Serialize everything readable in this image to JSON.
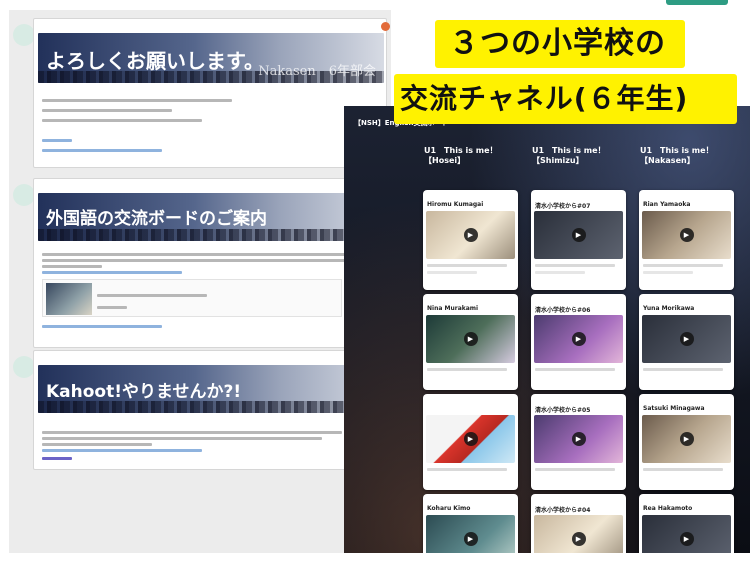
{
  "caption": {
    "line1": "３つの小学校の",
    "line2": "交流チャネル(６年生)"
  },
  "feed": {
    "avatar_label": "",
    "date_separator": "",
    "posts": [
      {
        "banner_title": "よろしくお願いします。",
        "banner_sub": "Nakasen　6年部会",
        "body_title": "",
        "reactions": "",
        "link_title": ""
      },
      {
        "banner_title": "外国語の交流ボードのご案内",
        "banner_sub": "",
        "body_title": "",
        "reactions": "",
        "link_title": ""
      },
      {
        "banner_title": "Kahoot!やりませんか?!",
        "banner_sub": "",
        "body_title": "",
        "reactions": "",
        "link_title": ""
      }
    ]
  },
  "board": {
    "crumb": "",
    "title": "【NSH】English交流ボード",
    "description": "",
    "columns": [
      {
        "line1": "U1　This is me！",
        "line2": "【Hosei】"
      },
      {
        "line1": "U1　This is me！",
        "line2": "【Shimizu】"
      },
      {
        "line1": "U1　This is me！",
        "line2": "【Nakasen】"
      }
    ],
    "cards": [
      {
        "meta": "",
        "title": "Hiromu Kumagai",
        "play": "▶",
        "heart": ""
      },
      {
        "meta": "",
        "title": "清水小学校から#07",
        "play": "▶",
        "heart": ""
      },
      {
        "meta": "",
        "title": "Rian Yamaoka",
        "play": "▶",
        "heart": ""
      },
      {
        "meta": "",
        "title": "Nina Murakami",
        "play": "▶",
        "heart": ""
      },
      {
        "meta": "",
        "title": "清水小学校から#06",
        "play": "▶",
        "heart": ""
      },
      {
        "meta": "",
        "title": "Yuna Morikawa",
        "play": "▶",
        "heart": ""
      },
      {
        "meta": "",
        "title": "",
        "play": "▶",
        "heart": ""
      },
      {
        "meta": "",
        "title": "清水小学校から#05",
        "play": "▶",
        "heart": ""
      },
      {
        "meta": "",
        "title": "Satsuki Minagawa",
        "play": "▶",
        "heart": ""
      },
      {
        "meta": "",
        "title": "Koharu Kimo",
        "play": "▶",
        "heart": ""
      },
      {
        "meta": "",
        "title": "清水小学校から#04",
        "play": "▶",
        "heart": ""
      },
      {
        "meta": "",
        "title": "Rea Hakamoto",
        "play": "▶",
        "heart": ""
      }
    ]
  },
  "colors": {
    "caption_bg": "#fff200",
    "accent_green": "#2e9c83",
    "banner_dark": "#22315a",
    "board_bg": "#131722",
    "close_dot": "#e26b3a"
  }
}
